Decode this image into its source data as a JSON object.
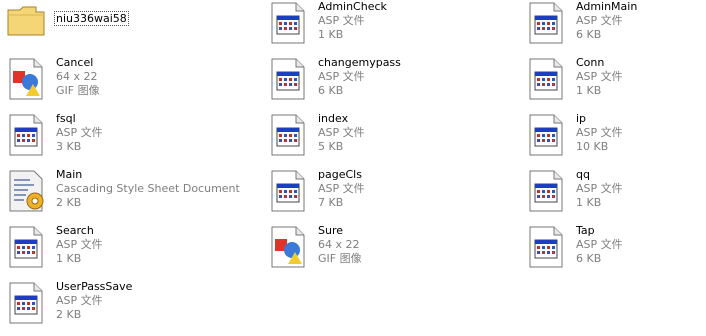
{
  "files": [
    {
      "name": "niu336wai58",
      "type": "folder"
    },
    {
      "name": "AdminCheck",
      "kind": "ASP 文件",
      "size": "1 KB",
      "type": "asp"
    },
    {
      "name": "AdminMain",
      "kind": "ASP 文件",
      "size": "6 KB",
      "type": "asp"
    },
    {
      "name": "Cancel",
      "kind": "64 x 22",
      "size": "GIF 图像",
      "type": "gif"
    },
    {
      "name": "changemypass",
      "kind": "ASP 文件",
      "size": "6 KB",
      "type": "asp"
    },
    {
      "name": "Conn",
      "kind": "ASP 文件",
      "size": "1 KB",
      "type": "asp"
    },
    {
      "name": "fsql",
      "kind": "ASP 文件",
      "size": "3 KB",
      "type": "asp"
    },
    {
      "name": "index",
      "kind": "ASP 文件",
      "size": "5 KB",
      "type": "asp"
    },
    {
      "name": "ip",
      "kind": "ASP 文件",
      "size": "10 KB",
      "type": "asp"
    },
    {
      "name": "Main",
      "kind": "Cascading Style Sheet Document",
      "size": "2 KB",
      "type": "css"
    },
    {
      "name": "pageCls",
      "kind": "ASP 文件",
      "size": "7 KB",
      "type": "asp"
    },
    {
      "name": "qq",
      "kind": "ASP 文件",
      "size": "1 KB",
      "type": "asp"
    },
    {
      "name": "Search",
      "kind": "ASP 文件",
      "size": "1 KB",
      "type": "asp"
    },
    {
      "name": "Sure",
      "kind": "64 x 22",
      "size": "GIF 图像",
      "type": "gif"
    },
    {
      "name": "Tap",
      "kind": "ASP 文件",
      "size": "6 KB",
      "type": "asp"
    },
    {
      "name": "UserPassSave",
      "kind": "ASP 文件",
      "size": "2 KB",
      "type": "asp"
    }
  ],
  "colors": {
    "folder": "#f4d676",
    "asp_titlebar": "#1c3fbf",
    "gif_red": "#e0332a",
    "gif_blue": "#3a79d8",
    "gif_yellow": "#f1cc2e"
  }
}
